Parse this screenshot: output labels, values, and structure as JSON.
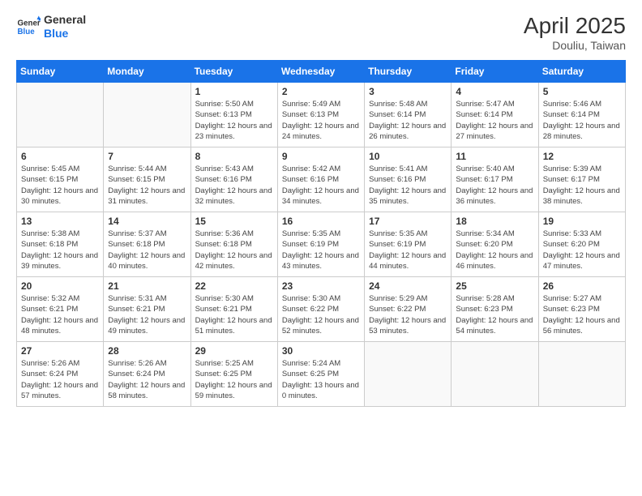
{
  "logo": {
    "line1": "General",
    "line2": "Blue"
  },
  "title": "April 2025",
  "subtitle": "Douliu, Taiwan",
  "weekdays": [
    "Sunday",
    "Monday",
    "Tuesday",
    "Wednesday",
    "Thursday",
    "Friday",
    "Saturday"
  ],
  "weeks": [
    [
      {
        "day": null,
        "info": null
      },
      {
        "day": null,
        "info": null
      },
      {
        "day": "1",
        "info": "Sunrise: 5:50 AM\nSunset: 6:13 PM\nDaylight: 12 hours and 23 minutes."
      },
      {
        "day": "2",
        "info": "Sunrise: 5:49 AM\nSunset: 6:13 PM\nDaylight: 12 hours and 24 minutes."
      },
      {
        "day": "3",
        "info": "Sunrise: 5:48 AM\nSunset: 6:14 PM\nDaylight: 12 hours and 26 minutes."
      },
      {
        "day": "4",
        "info": "Sunrise: 5:47 AM\nSunset: 6:14 PM\nDaylight: 12 hours and 27 minutes."
      },
      {
        "day": "5",
        "info": "Sunrise: 5:46 AM\nSunset: 6:14 PM\nDaylight: 12 hours and 28 minutes."
      }
    ],
    [
      {
        "day": "6",
        "info": "Sunrise: 5:45 AM\nSunset: 6:15 PM\nDaylight: 12 hours and 30 minutes."
      },
      {
        "day": "7",
        "info": "Sunrise: 5:44 AM\nSunset: 6:15 PM\nDaylight: 12 hours and 31 minutes."
      },
      {
        "day": "8",
        "info": "Sunrise: 5:43 AM\nSunset: 6:16 PM\nDaylight: 12 hours and 32 minutes."
      },
      {
        "day": "9",
        "info": "Sunrise: 5:42 AM\nSunset: 6:16 PM\nDaylight: 12 hours and 34 minutes."
      },
      {
        "day": "10",
        "info": "Sunrise: 5:41 AM\nSunset: 6:16 PM\nDaylight: 12 hours and 35 minutes."
      },
      {
        "day": "11",
        "info": "Sunrise: 5:40 AM\nSunset: 6:17 PM\nDaylight: 12 hours and 36 minutes."
      },
      {
        "day": "12",
        "info": "Sunrise: 5:39 AM\nSunset: 6:17 PM\nDaylight: 12 hours and 38 minutes."
      }
    ],
    [
      {
        "day": "13",
        "info": "Sunrise: 5:38 AM\nSunset: 6:18 PM\nDaylight: 12 hours and 39 minutes."
      },
      {
        "day": "14",
        "info": "Sunrise: 5:37 AM\nSunset: 6:18 PM\nDaylight: 12 hours and 40 minutes."
      },
      {
        "day": "15",
        "info": "Sunrise: 5:36 AM\nSunset: 6:18 PM\nDaylight: 12 hours and 42 minutes."
      },
      {
        "day": "16",
        "info": "Sunrise: 5:35 AM\nSunset: 6:19 PM\nDaylight: 12 hours and 43 minutes."
      },
      {
        "day": "17",
        "info": "Sunrise: 5:35 AM\nSunset: 6:19 PM\nDaylight: 12 hours and 44 minutes."
      },
      {
        "day": "18",
        "info": "Sunrise: 5:34 AM\nSunset: 6:20 PM\nDaylight: 12 hours and 46 minutes."
      },
      {
        "day": "19",
        "info": "Sunrise: 5:33 AM\nSunset: 6:20 PM\nDaylight: 12 hours and 47 minutes."
      }
    ],
    [
      {
        "day": "20",
        "info": "Sunrise: 5:32 AM\nSunset: 6:21 PM\nDaylight: 12 hours and 48 minutes."
      },
      {
        "day": "21",
        "info": "Sunrise: 5:31 AM\nSunset: 6:21 PM\nDaylight: 12 hours and 49 minutes."
      },
      {
        "day": "22",
        "info": "Sunrise: 5:30 AM\nSunset: 6:21 PM\nDaylight: 12 hours and 51 minutes."
      },
      {
        "day": "23",
        "info": "Sunrise: 5:30 AM\nSunset: 6:22 PM\nDaylight: 12 hours and 52 minutes."
      },
      {
        "day": "24",
        "info": "Sunrise: 5:29 AM\nSunset: 6:22 PM\nDaylight: 12 hours and 53 minutes."
      },
      {
        "day": "25",
        "info": "Sunrise: 5:28 AM\nSunset: 6:23 PM\nDaylight: 12 hours and 54 minutes."
      },
      {
        "day": "26",
        "info": "Sunrise: 5:27 AM\nSunset: 6:23 PM\nDaylight: 12 hours and 56 minutes."
      }
    ],
    [
      {
        "day": "27",
        "info": "Sunrise: 5:26 AM\nSunset: 6:24 PM\nDaylight: 12 hours and 57 minutes."
      },
      {
        "day": "28",
        "info": "Sunrise: 5:26 AM\nSunset: 6:24 PM\nDaylight: 12 hours and 58 minutes."
      },
      {
        "day": "29",
        "info": "Sunrise: 5:25 AM\nSunset: 6:25 PM\nDaylight: 12 hours and 59 minutes."
      },
      {
        "day": "30",
        "info": "Sunrise: 5:24 AM\nSunset: 6:25 PM\nDaylight: 13 hours and 0 minutes."
      },
      {
        "day": null,
        "info": null
      },
      {
        "day": null,
        "info": null
      },
      {
        "day": null,
        "info": null
      }
    ]
  ]
}
